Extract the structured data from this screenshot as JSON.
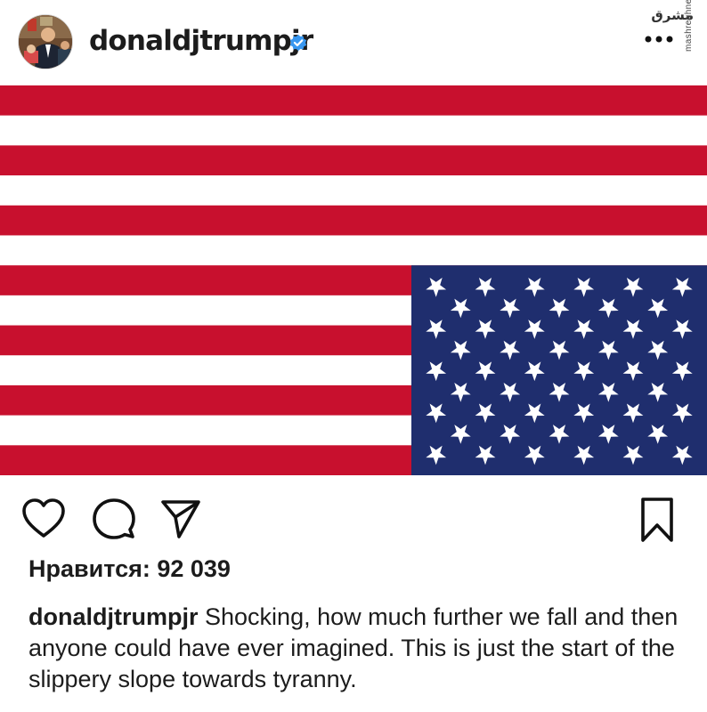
{
  "post": {
    "username": "donaldjtrumpjr",
    "verified": true,
    "avatar_icon": "profile-photo-icon",
    "more_icon": "more-options-icon",
    "image": {
      "subject": "upside-down-us-flag",
      "stripe_red": "#c8102e",
      "stripe_white": "#ffffff",
      "canton_blue": "#1f2e6e",
      "star_color": "#ffffff"
    }
  },
  "watermark": {
    "logo": "مشرق",
    "url": "mashreghnews.ir"
  },
  "actions": {
    "like_icon": "heart-icon",
    "comment_icon": "comment-bubble-icon",
    "share_icon": "paper-plane-icon",
    "save_icon": "bookmark-icon"
  },
  "likes": {
    "text": "Нравится: 92 039"
  },
  "caption": {
    "username": "donaldjtrumpjr",
    "text": "Shocking, how much further we fall and then anyone could have ever imagined. This is just the start of the slippery slope towards tyranny."
  },
  "colors": {
    "verified_badge": "#3897f0",
    "text": "#1c1c1c"
  }
}
